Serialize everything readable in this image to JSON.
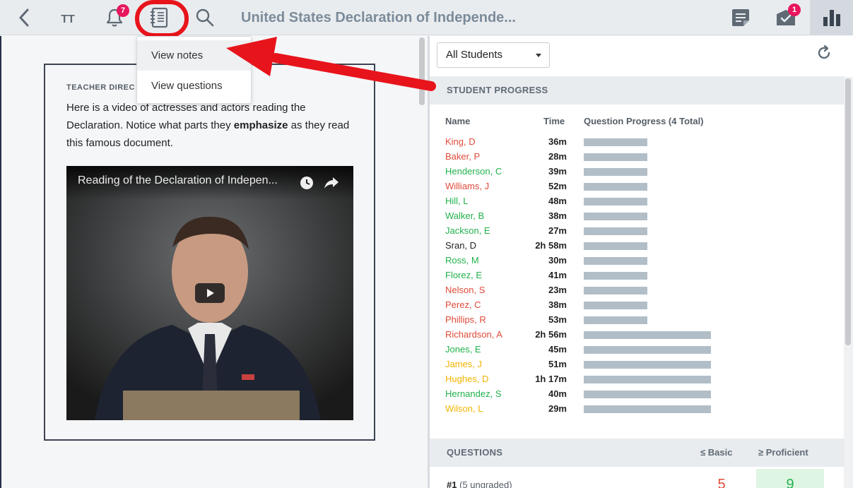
{
  "toolbar": {
    "back_icon": "chevron-left-icon",
    "text_size_label": "TT",
    "notifications_badge": "7",
    "notes_icon": "notebook-icon",
    "search_icon": "search-icon",
    "title": "United States Declaration of Independe...",
    "assignments_badge": "1",
    "accent_ring_color": "#e8141b"
  },
  "menu": {
    "items": [
      {
        "label": "View notes"
      },
      {
        "label": "View questions"
      }
    ]
  },
  "card": {
    "label": "TEACHER DIREC",
    "text_before": "Here is a video of actresses and actors reading the Declaration. Notice what parts they ",
    "text_bold": "emphasize",
    "text_after": " as they read this famous document.",
    "video_title": "Reading of the Declaration of Indepen..."
  },
  "filter": {
    "selected": "All Students"
  },
  "progress": {
    "heading": "STUDENT PROGRESS",
    "col_name": "Name",
    "col_time": "Time",
    "col_progress": "Question Progress (4 Total)",
    "students": [
      {
        "name": "King, D",
        "time": "36m",
        "color": "red",
        "progress": 2
      },
      {
        "name": "Baker, P",
        "time": "28m",
        "color": "red",
        "progress": 2
      },
      {
        "name": "Henderson, C",
        "time": "39m",
        "color": "green",
        "progress": 2
      },
      {
        "name": "Williams, J",
        "time": "52m",
        "color": "red",
        "progress": 2
      },
      {
        "name": "Hill, L",
        "time": "48m",
        "color": "green",
        "progress": 2
      },
      {
        "name": "Walker, B",
        "time": "38m",
        "color": "green",
        "progress": 2
      },
      {
        "name": "Jackson, E",
        "time": "27m",
        "color": "green",
        "progress": 2
      },
      {
        "name": "Sran, D",
        "time": "2h 58m",
        "color": "black",
        "progress": 2
      },
      {
        "name": "Ross, M",
        "time": "30m",
        "color": "green",
        "progress": 2
      },
      {
        "name": "Florez, E",
        "time": "41m",
        "color": "green",
        "progress": 2
      },
      {
        "name": "Nelson, S",
        "time": "23m",
        "color": "red",
        "progress": 2
      },
      {
        "name": "Perez, C",
        "time": "38m",
        "color": "red",
        "progress": 2
      },
      {
        "name": "Phillips, R",
        "time": "53m",
        "color": "red",
        "progress": 2
      },
      {
        "name": "Richardson, A",
        "time": "2h 56m",
        "color": "red",
        "progress": 4
      },
      {
        "name": "Jones, E",
        "time": "45m",
        "color": "green",
        "progress": 4
      },
      {
        "name": "James, J",
        "time": "51m",
        "color": "yellow",
        "progress": 4
      },
      {
        "name": "Hughes, D",
        "time": "1h 17m",
        "color": "yellow",
        "progress": 4
      },
      {
        "name": "Hernandez, S",
        "time": "40m",
        "color": "green",
        "progress": 4
      },
      {
        "name": "Wilson, L",
        "time": "29m",
        "color": "yellow",
        "progress": 4
      }
    ]
  },
  "questions": {
    "heading": "QUESTIONS",
    "col_basic": "≤ Basic",
    "col_proficient": "≥ Proficient",
    "rows": [
      {
        "label": "#1",
        "note": "(5 ungraded)",
        "basic": "5",
        "proficient": "9"
      }
    ]
  },
  "colors": {
    "red": "#e04a3a",
    "green": "#22b14c",
    "yellow": "#f2b400",
    "black": "#222222",
    "bar": "#b2bec7",
    "badge": "#e8175d"
  }
}
